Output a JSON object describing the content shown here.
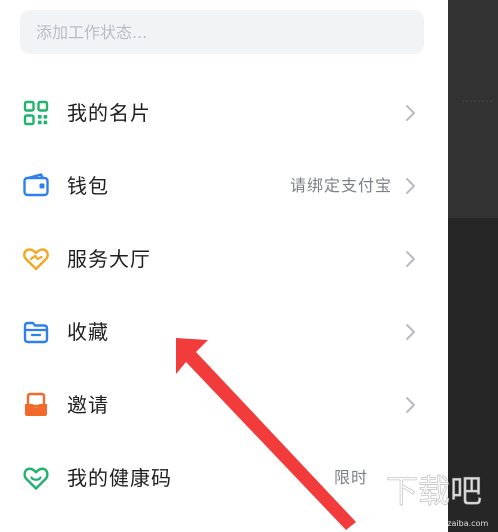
{
  "status_field": {
    "placeholder": "添加工作状态..."
  },
  "menu": [
    {
      "label": "我的名片",
      "sub": "",
      "icon": "qr-card-icon",
      "color": "#1fb36b"
    },
    {
      "label": "钱包",
      "sub": "请绑定支付宝",
      "icon": "wallet-icon",
      "color": "#2f80ed"
    },
    {
      "label": "服务大厅",
      "sub": "",
      "icon": "heart-hall-icon",
      "color": "#f5a623"
    },
    {
      "label": "收藏",
      "sub": "",
      "icon": "folder-icon",
      "color": "#2f80ed"
    },
    {
      "label": "邀请",
      "sub": "",
      "icon": "invite-box-icon",
      "color": "#f26a2b"
    },
    {
      "label": "我的健康码",
      "sub": "限时",
      "icon": "health-heart-icon",
      "color": "#1fb36b"
    }
  ],
  "annotation": {
    "arrow_color": "#f23b3b"
  },
  "watermark": {
    "text": "下载吧",
    "sub_text": "www.xiazaiba.com"
  }
}
